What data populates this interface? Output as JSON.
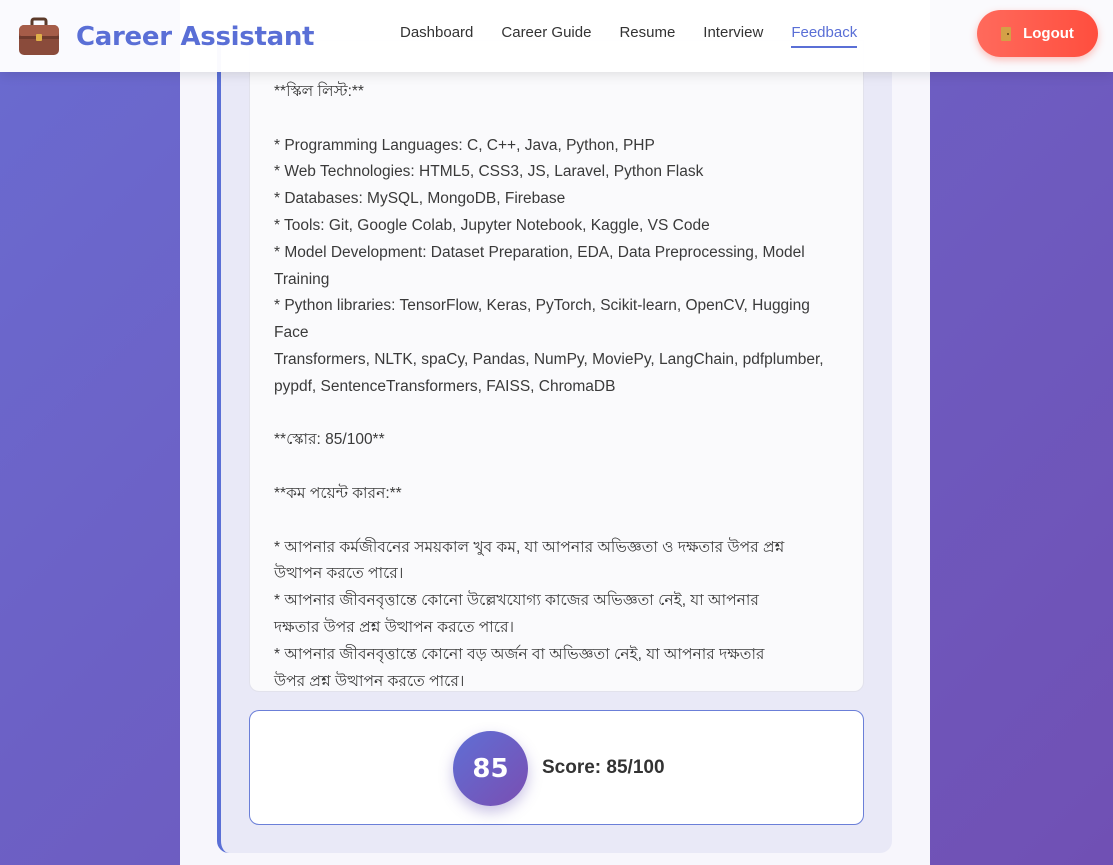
{
  "header": {
    "brand_title": "Career Assistant",
    "brand_icon": "briefcase-icon",
    "nav": [
      {
        "label": "Dashboard",
        "active": false
      },
      {
        "label": "Career Guide",
        "active": false
      },
      {
        "label": "Resume",
        "active": false
      },
      {
        "label": "Interview",
        "active": false
      },
      {
        "label": "Feedback",
        "active": true
      }
    ],
    "logout_label": "Logout",
    "logout_icon": "door-icon",
    "accent_color": "#5a6fd6",
    "logout_color": "#ff5a4a"
  },
  "feedback": {
    "text": "**স্কিল লিস্ট:**\n\n* Programming Languages: C, C++, Java, Python, PHP\n* Web Technologies: HTML5, CSS3, JS, Laravel, Python Flask\n* Databases: MySQL, MongoDB, Firebase\n* Tools: Git, Google Colab, Jupyter Notebook, Kaggle, VS Code\n* Model Development: Dataset Preparation, EDA, Data Preprocessing, Model\nTraining\n* Python libraries: TensorFlow, Keras, PyTorch, Scikit-learn, OpenCV, Hugging Face\nTransformers, NLTK, spaCy, Pandas, NumPy, MoviePy, LangChain, pdfplumber,\npypdf, SentenceTransformers, FAISS, ChromaDB\n\n**স্কোর: 85/100**\n\n**কম পয়েন্ট কারন:**\n\n* আপনার কর্মজীবনের সময়কাল খুব কম, যা আপনার অভিজ্ঞতা ও দক্ষতার উপর প্রশ্ন\nউত্থাপন করতে পারে।\n* আপনার জীবনবৃত্তান্তে কোনো উল্লেখযোগ্য কাজের অভিজ্ঞতা নেই, যা আপনার\nদক্ষতার উপর প্রশ্ন উত্থাপন করতে পারে।\n* আপনার জীবনবৃত্তান্তে কোনো বড় অর্জন বা অভিজ্ঞতা নেই, যা আপনার দক্ষতার\nউপর প্রশ্ন উত্থাপন করতে পারে।"
  },
  "score": {
    "value": "85",
    "label": "Score: 85/100"
  }
}
